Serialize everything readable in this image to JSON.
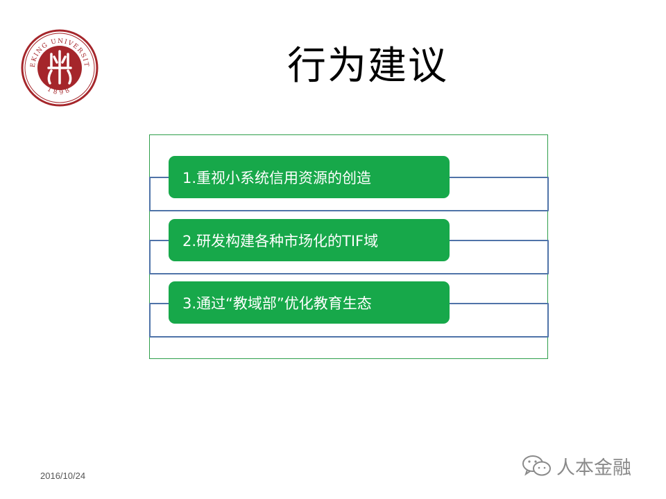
{
  "logo": {
    "text_top": "PEKING UNIVERSITY",
    "year": "1898",
    "color": "#a5262b"
  },
  "slide": {
    "title": "行为建议",
    "items": [
      {
        "label": "1.重视小系统信用资源的创造"
      },
      {
        "label": "2.研发构建各种市场化的TIF域"
      },
      {
        "label": "3.通过“教域部”优化教育生态"
      }
    ],
    "date": "2016/10/24"
  },
  "watermark": {
    "icon": "wechat-icon",
    "text": "人本金融"
  },
  "colors": {
    "item_green": "#17a84a",
    "bar_border_blue": "#4f73a8",
    "frame_green": "#2e9e4a"
  }
}
